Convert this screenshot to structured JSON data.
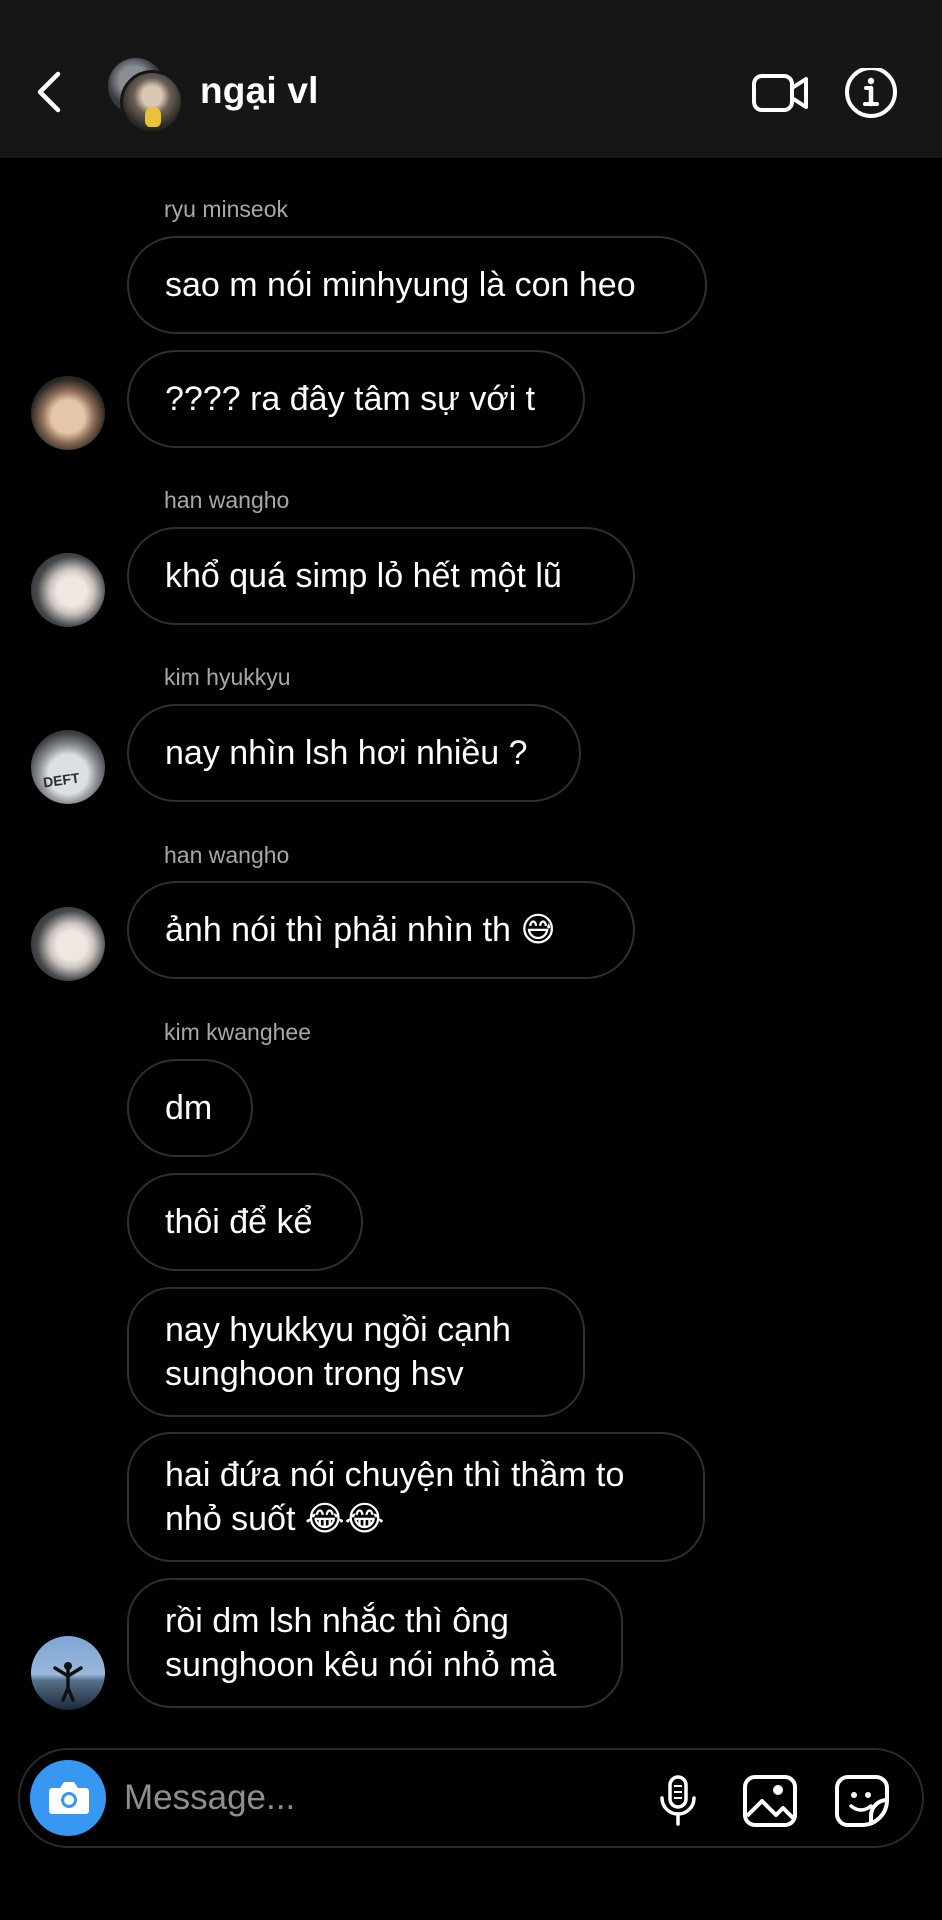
{
  "header": {
    "title": "ngại vl"
  },
  "messages": [
    {
      "sender": "ryu minseok",
      "texts": [
        "sao m nói minhyung là con heo",
        "???? ra đây tâm sự với t"
      ]
    },
    {
      "sender": "han wangho",
      "texts": [
        "khổ quá simp lỏ hết một lũ"
      ]
    },
    {
      "sender": "kim hyukkyu",
      "texts": [
        "nay nhìn lsh hơi nhiều ?"
      ],
      "avatar_text": "DEFT"
    },
    {
      "sender": "han wangho",
      "texts": [
        "ảnh nói thì phải nhìn th 😅"
      ]
    },
    {
      "sender": "kim kwanghee",
      "texts": [
        "dm",
        "thôi để kể",
        "nay hyukkyu ngồi cạnh\nsunghoon trong hsv",
        "hai đứa nói chuyện thì thầm to\nnhỏ suốt 😂😂",
        "rồi dm lsh nhắc thì ông\nsunghoon kêu nói nhỏ mà"
      ]
    }
  ],
  "composer": {
    "placeholder": "Message..."
  },
  "icons": {
    "back": "chevron-left-icon",
    "video": "video-camera-icon",
    "info": "info-icon",
    "camera": "camera-icon",
    "mic": "microphone-icon",
    "gallery": "image-icon",
    "sticker": "sticker-icon"
  },
  "colors": {
    "header_bg": "#161616",
    "bubble_border": "#2f2f2f",
    "accent": "#3897f0"
  }
}
